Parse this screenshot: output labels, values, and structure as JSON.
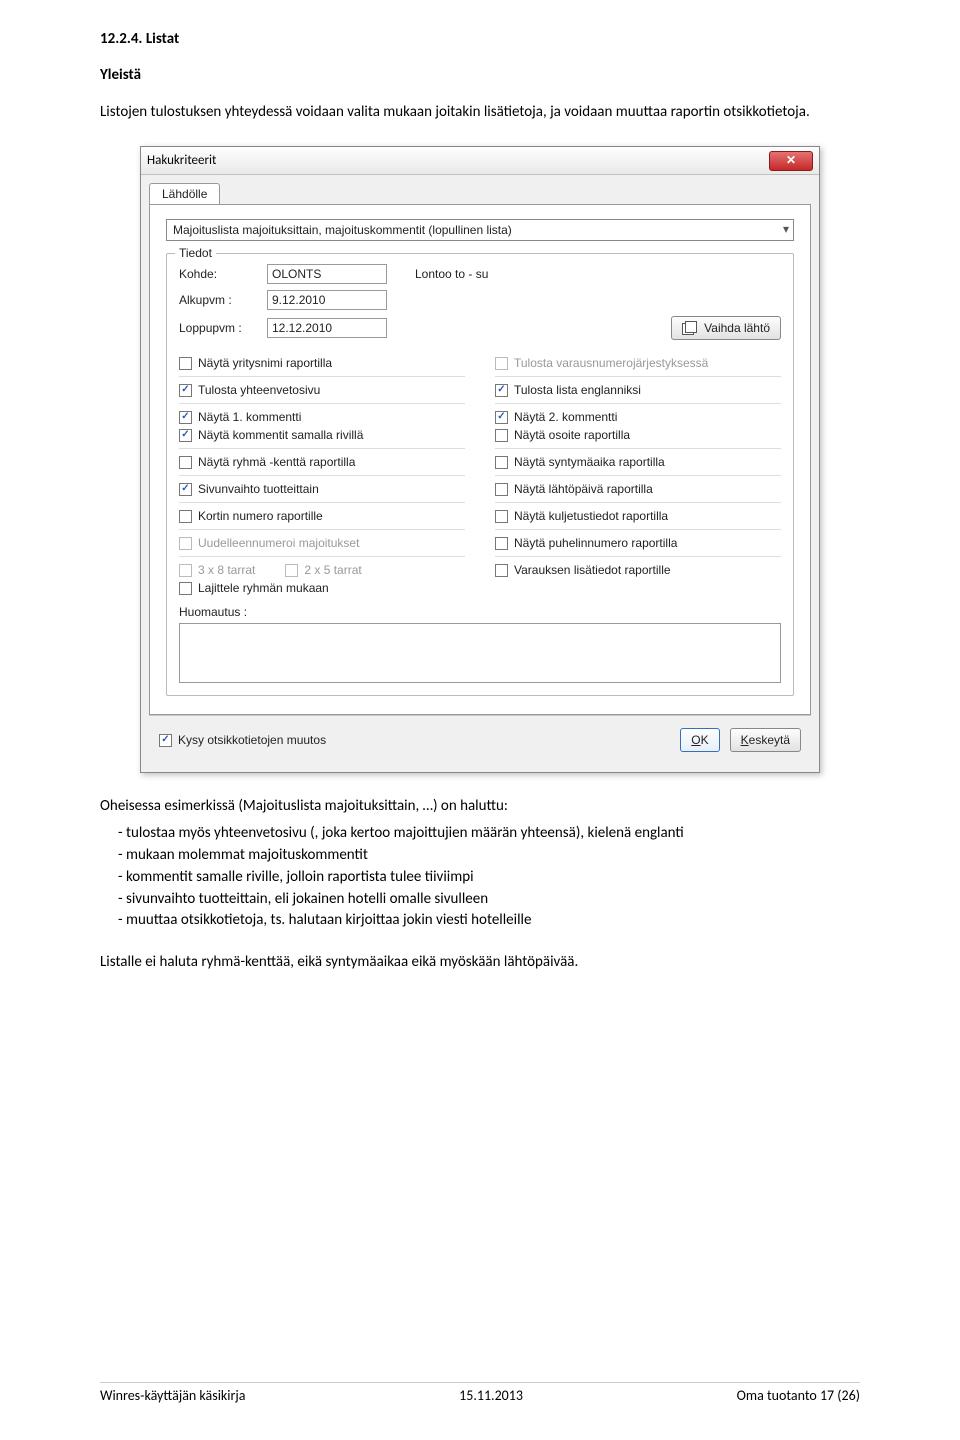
{
  "section": {
    "number": "12.2.4. Listat",
    "subtitle": "Yleistä"
  },
  "intro": "Listojen tulostuksen yhteydessä voidaan valita mukaan joitakin lisätietoja, ja voidaan muuttaa raportin otsikkotietoja.",
  "dialog": {
    "title": "Hakukriteerit",
    "tab": "Lähdölle",
    "combo": "Majoituslista majoituksittain, majoituskommentit (lopullinen lista)",
    "group_legend": "Tiedot",
    "labels": {
      "kohde": "Kohde:",
      "alkupvm": "Alkupvm :",
      "loppupvm": "Loppupvm :"
    },
    "fields": {
      "kohde": "OLONTS",
      "kohde_desc": "Lontoo to - su",
      "alkupvm": "9.12.2010",
      "loppupvm": "12.12.2010"
    },
    "vaihda_btn": "Vaihda lähtö",
    "checks_left": [
      {
        "label": "Näytä yritysnimi raportilla",
        "checked": false,
        "disabled": false
      },
      {
        "label": "Tulosta yhteenvetosivu",
        "checked": true,
        "disabled": false
      },
      {
        "label": "Näytä 1. kommentti",
        "checked": true,
        "disabled": false
      },
      {
        "label": "Näytä kommentit samalla rivillä",
        "checked": true,
        "disabled": false
      },
      {
        "label": "Näytä ryhmä -kenttä raportilla",
        "checked": false,
        "disabled": false
      },
      {
        "label": "Sivunvaihto tuotteittain",
        "checked": true,
        "disabled": false
      },
      {
        "label": "Kortin numero raportille",
        "checked": false,
        "disabled": false
      },
      {
        "label": "Uudelleennumeroi majoitukset",
        "checked": false,
        "disabled": true
      },
      {
        "label": "3 x 8 tarrat",
        "checked": false,
        "disabled": true
      },
      {
        "label": "Lajittele ryhmän mukaan",
        "checked": false,
        "disabled": false
      }
    ],
    "checks_left_extra": {
      "label": "2 x 5 tarrat",
      "checked": false,
      "disabled": true
    },
    "checks_right": [
      {
        "label": "Tulosta varausnumerojärjestyksessä",
        "checked": false,
        "disabled": true
      },
      {
        "label": "Tulosta lista englanniksi",
        "checked": true,
        "disabled": false
      },
      {
        "label": "Näytä 2. kommentti",
        "checked": true,
        "disabled": false
      },
      {
        "label": "Näytä osoite raportilla",
        "checked": false,
        "disabled": false
      },
      {
        "label": "Näytä syntymäaika raportilla",
        "checked": false,
        "disabled": false
      },
      {
        "label": "Näytä lähtöpäivä raportilla",
        "checked": false,
        "disabled": false
      },
      {
        "label": "Näytä kuljetustiedot raportilla",
        "checked": false,
        "disabled": false
      },
      {
        "label": "Näytä puhelinnumero raportilla",
        "checked": false,
        "disabled": false
      },
      {
        "label": "Varauksen lisätiedot raportille",
        "checked": false,
        "disabled": false
      }
    ],
    "huom_label": "Huomautus :",
    "footer_check": {
      "label": "Kysy otsikkotietojen muutos",
      "checked": true
    },
    "ok": "OK",
    "cancel": "Keskeytä"
  },
  "post_intro": "Oheisessa esimerkissä (Majoituslista majoituksittain, …) on haluttu:",
  "bullets": [
    "tulostaa myös yhteenvetosivu (, joka kertoo majoittujien määrän yhteensä), kielenä englanti",
    "mukaan molemmat majoituskommentit",
    "kommentit samalle riville, jolloin raportista tulee tiiviimpi",
    "sivunvaihto tuotteittain, eli jokainen hotelli omalle sivulleen",
    "muuttaa otsikkotietoja, ts. halutaan kirjoittaa jokin viesti hotelleille"
  ],
  "post_para": "Listalle ei haluta ryhmä-kenttää, eikä syntymäaikaa eikä myöskään lähtöpäivää.",
  "footer": {
    "left": "Winres-käyttäjän käsikirja",
    "center": "15.11.2013",
    "right": "Oma tuotanto 17 (26)"
  }
}
